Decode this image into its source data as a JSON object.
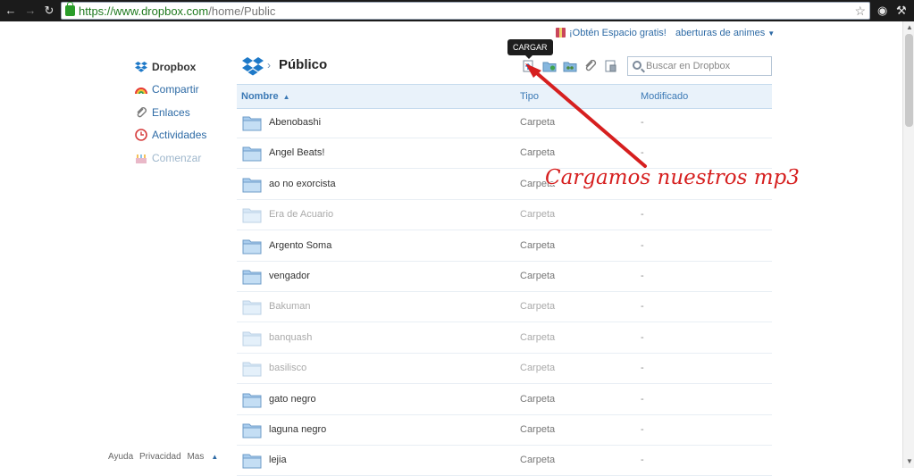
{
  "browser": {
    "url_host": "https://www.dropbox.com",
    "url_path": "/home/Public"
  },
  "topbar": {
    "promo_label": "¡Obtén Espacio gratis!",
    "account_label": "aberturas de animes"
  },
  "sidebar": {
    "items": [
      {
        "label": "Dropbox"
      },
      {
        "label": "Compartir"
      },
      {
        "label": "Enlaces"
      },
      {
        "label": "Actividades"
      },
      {
        "label": "Comenzar"
      }
    ],
    "footer": [
      "Ayuda",
      "Privacidad",
      "Mas"
    ]
  },
  "header": {
    "title": "Público",
    "tooltip": "CARGAR",
    "search_placeholder": "Buscar en Dropbox"
  },
  "table": {
    "columns": [
      "Nombre",
      "Tipo",
      "Modificado"
    ],
    "rows": [
      {
        "name": "Abenobashi",
        "type": "Carpeta",
        "modified": "-"
      },
      {
        "name": "Angel Beats!",
        "type": "Carpeta",
        "modified": "-"
      },
      {
        "name": "ao no exorcista",
        "type": "Carpeta",
        "modified": "-"
      },
      {
        "name": "Era de Acuario",
        "type": "Carpeta",
        "modified": "-"
      },
      {
        "name": "Argento Soma",
        "type": "Carpeta",
        "modified": "-"
      },
      {
        "name": "vengador",
        "type": "Carpeta",
        "modified": "-"
      },
      {
        "name": "Bakuman",
        "type": "Carpeta",
        "modified": "-"
      },
      {
        "name": "banquash",
        "type": "Carpeta",
        "modified": "-"
      },
      {
        "name": "basilisco",
        "type": "Carpeta",
        "modified": "-"
      },
      {
        "name": "gato negro",
        "type": "Carpeta",
        "modified": "-"
      },
      {
        "name": "laguna negro",
        "type": "Carpeta",
        "modified": "-"
      },
      {
        "name": "lejia",
        "type": "Carpeta",
        "modified": "-"
      }
    ]
  },
  "annotation": {
    "text": "Cargamos nuestros mp3",
    "color": "#d61f1f"
  },
  "colors": {
    "link": "#2d6aa5",
    "header_bg": "#e9f2fa"
  }
}
